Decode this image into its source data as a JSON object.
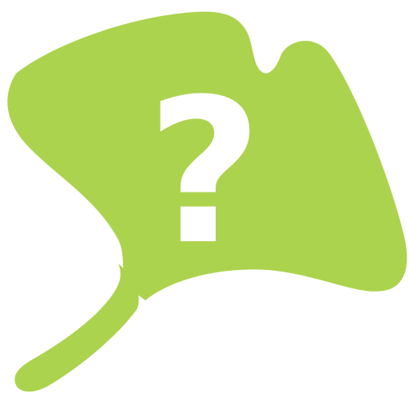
{
  "logo": {
    "icon": "ginkgo-leaf-question-icon",
    "symbol": "?",
    "leaf_color": "#acd34e",
    "symbol_color": "#ffffff"
  }
}
